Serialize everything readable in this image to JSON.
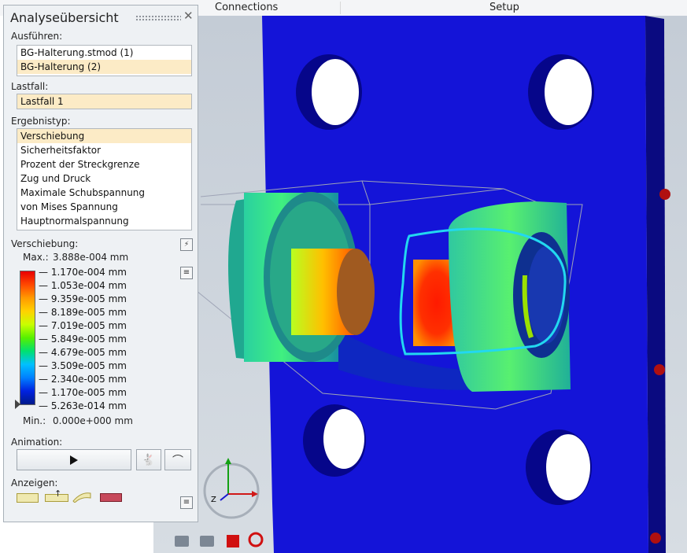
{
  "topbar": {
    "tab_connections": "Connections",
    "tab_setup": "Setup"
  },
  "panel": {
    "title": "Analyseübersicht",
    "run_label": "Ausführen:",
    "runs": [
      "BG-Halterung.stmod (1)",
      "BG-Halterung (2)"
    ],
    "loadcase_label": "Lastfall:",
    "loadcase": "Lastfall 1",
    "result_type_label": "Ergebnistyp:",
    "result_types": [
      "Verschiebung",
      "Sicherheitsfaktor",
      "Prozent der Streckgrenze",
      "Zug und Druck",
      "Maximale Schubspannung",
      "von Mises Spannung",
      "Hauptnormalspannung"
    ],
    "legend_label": "Verschiebung:",
    "max_label": "Max.:",
    "max_value": "3.888e-004 mm",
    "ticks": [
      "— 1.170e-004 mm",
      "— 1.053e-004 mm",
      "— 9.359e-005 mm",
      "— 8.189e-005 mm",
      "— 7.019e-005 mm",
      "— 5.849e-005 mm",
      "— 4.679e-005 mm",
      "— 3.509e-005 mm",
      "— 2.340e-005 mm",
      "— 1.170e-005 mm",
      "— 5.263e-014 mm"
    ],
    "min_label": "Min.:",
    "min_value": "0.000e+000 mm",
    "animation_label": "Animation:",
    "display_label": "Anzeigen:"
  },
  "triad": {
    "z_label": "Z"
  },
  "colors": {
    "plate_blue": "#1414d8",
    "selection": "#fcebc6",
    "highlight_ring": "#22d8f0"
  }
}
